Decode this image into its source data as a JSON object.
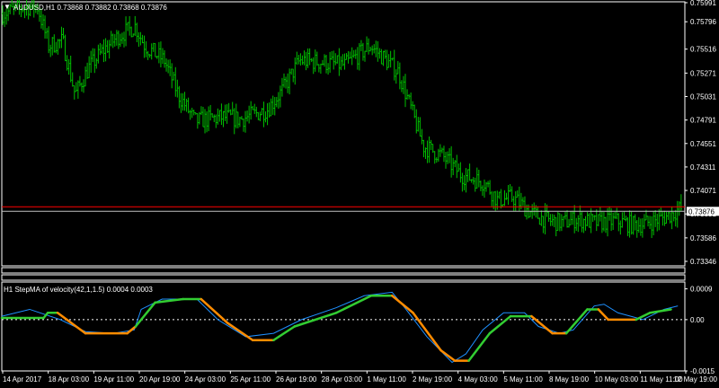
{
  "colors": {
    "background": "#000000",
    "axis": "#ffffff",
    "candles": "#00c000",
    "price_line_red": "#ff0000",
    "price_line_grey": "#c0c0c0",
    "stepma_up": "#32cd32",
    "stepma_down": "#ff8c00",
    "velocity": "#1e90ff",
    "current_price_bg": "#ffffff",
    "current_price_fg": "#000000"
  },
  "icons": {
    "window_menu": "triangle-down-icon"
  },
  "main_chart": {
    "title": "AUDUSD,H1  0.73868 0.73882 0.73868 0.73876",
    "y_ticks": [
      "0.75991",
      "0.75796",
      "0.75516",
      "0.75271",
      "0.75031",
      "0.74791",
      "0.74551",
      "0.74311",
      "0.74071",
      "0.73831",
      "0.73586",
      "0.73346"
    ],
    "current_price": "0.73876"
  },
  "indicator": {
    "title": "H1 StepMA of velocity(42,1,1.5) 0.0004 0.0003",
    "y_ticks": [
      "0.0009",
      "0.00",
      "-0.0015"
    ]
  },
  "x_axis": {
    "labels": [
      "14 Apr 2017",
      "18 Apr 03:00",
      "19 Apr 11:00",
      "20 Apr 19:00",
      "24 Apr 03:00",
      "25 Apr 11:00",
      "26 Apr 19:00",
      "28 Apr 03:00",
      "1 May 11:00",
      "2 May 19:00",
      "4 May 03:00",
      "5 May 11:00",
      "8 May 19:00",
      "10 May 03:00",
      "11 May 11:00",
      "12 May 19:00"
    ]
  },
  "chart_data": {
    "type": "line",
    "symbol": "AUDUSD",
    "timeframe": "H1",
    "ylim": [
      0.733,
      0.76
    ],
    "price_path": [
      [
        0,
        0.7588
      ],
      [
        1.5,
        0.7595
      ],
      [
        2.5,
        0.7595
      ],
      [
        3.3,
        0.7555
      ],
      [
        4.3,
        0.756
      ],
      [
        5.2,
        0.7505
      ],
      [
        6.2,
        0.7533
      ],
      [
        7.2,
        0.755
      ],
      [
        8.3,
        0.7565
      ],
      [
        9.5,
        0.7575
      ],
      [
        10.2,
        0.7555
      ],
      [
        11.6,
        0.754
      ],
      [
        12.6,
        0.7505
      ],
      [
        13.8,
        0.7478
      ],
      [
        15.8,
        0.7482
      ],
      [
        17.1,
        0.748
      ],
      [
        19.0,
        0.749
      ],
      [
        20.1,
        0.751
      ],
      [
        21.3,
        0.754
      ],
      [
        23.0,
        0.7538
      ],
      [
        24.5,
        0.7535
      ],
      [
        26.4,
        0.7555
      ],
      [
        28.4,
        0.7528
      ],
      [
        30.2,
        0.7452
      ],
      [
        31.5,
        0.7443
      ],
      [
        32.9,
        0.7423
      ],
      [
        34.6,
        0.7415
      ],
      [
        35.5,
        0.7397
      ],
      [
        36.6,
        0.74
      ],
      [
        38.0,
        0.7383
      ],
      [
        39.2,
        0.7376
      ],
      [
        40.2,
        0.7374
      ],
      [
        41.2,
        0.7378
      ],
      [
        42.5,
        0.7374
      ],
      [
        44.0,
        0.7376
      ],
      [
        45.2,
        0.7372
      ],
      [
        46.0,
        0.7373
      ],
      [
        47.2,
        0.7378
      ],
      [
        48.0,
        0.7383
      ],
      [
        48.5,
        0.7388
      ]
    ],
    "velocity": [
      [
        0,
        0.0001
      ],
      [
        2.0,
        0.0003
      ],
      [
        4.2,
        0.0
      ],
      [
        6.0,
        -0.00035
      ],
      [
        8.0,
        -0.0004
      ],
      [
        9.5,
        -0.0003
      ],
      [
        10.0,
        0.0003
      ],
      [
        11.5,
        0.0006
      ],
      [
        14.0,
        0.0006
      ],
      [
        15.5,
        0.0
      ],
      [
        17.5,
        -0.0005
      ],
      [
        19.5,
        -0.0004
      ],
      [
        21.5,
        0.0
      ],
      [
        24.0,
        0.00035
      ],
      [
        26.0,
        0.0007
      ],
      [
        28.0,
        0.0008
      ],
      [
        29.0,
        0.0003
      ],
      [
        30.5,
        -0.0005
      ],
      [
        32.3,
        -0.00125
      ],
      [
        33.3,
        -0.001
      ],
      [
        34.5,
        -0.0003
      ],
      [
        36.0,
        0.0002
      ],
      [
        37.5,
        0.0002
      ],
      [
        38.5,
        -0.0002
      ],
      [
        40.0,
        -0.0004
      ],
      [
        41.0,
        -0.0003
      ],
      [
        42.5,
        0.0004
      ],
      [
        43.2,
        0.00045
      ],
      [
        44.2,
        0.0002
      ],
      [
        46.0,
        0.0
      ],
      [
        47.5,
        0.0003
      ],
      [
        48.5,
        0.0004
      ]
    ],
    "stepma": [
      [
        0,
        5e-05,
        "up"
      ],
      [
        3.0,
        5e-05,
        "up"
      ],
      [
        3.3,
        0.0002,
        "up"
      ],
      [
        4.0,
        0.0002,
        "down"
      ],
      [
        6.0,
        -0.0004,
        "down"
      ],
      [
        9.0,
        -0.0004,
        "down"
      ],
      [
        9.6,
        -0.0002,
        "up"
      ],
      [
        11.0,
        0.0005,
        "up"
      ],
      [
        13.0,
        0.0006,
        "up"
      ],
      [
        14.3,
        0.0006,
        "down"
      ],
      [
        16.2,
        -0.0001,
        "down"
      ],
      [
        18.0,
        -0.0006,
        "down"
      ],
      [
        19.5,
        -0.0006,
        "up"
      ],
      [
        21.0,
        -0.0002,
        "up"
      ],
      [
        24.0,
        0.0002,
        "up"
      ],
      [
        26.5,
        0.0007,
        "up"
      ],
      [
        28.0,
        0.0007,
        "down"
      ],
      [
        29.5,
        0.0002,
        "down"
      ],
      [
        31.5,
        -0.0009,
        "down"
      ],
      [
        32.5,
        -0.0012,
        "down"
      ],
      [
        33.5,
        -0.0012,
        "up"
      ],
      [
        35.0,
        -0.0004,
        "up"
      ],
      [
        36.5,
        0.0001,
        "up"
      ],
      [
        38.0,
        0.0001,
        "down"
      ],
      [
        39.5,
        -0.0004,
        "down"
      ],
      [
        40.5,
        -0.0004,
        "up"
      ],
      [
        42.0,
        0.0003,
        "up"
      ],
      [
        42.8,
        0.0003,
        "down"
      ],
      [
        43.5,
        0.0,
        "down"
      ],
      [
        45.5,
        0.0,
        "up"
      ],
      [
        46.5,
        0.0002,
        "up"
      ],
      [
        48.0,
        0.0003,
        "up"
      ]
    ],
    "indicator_ylim": [
      -0.0015,
      0.0011
    ]
  }
}
